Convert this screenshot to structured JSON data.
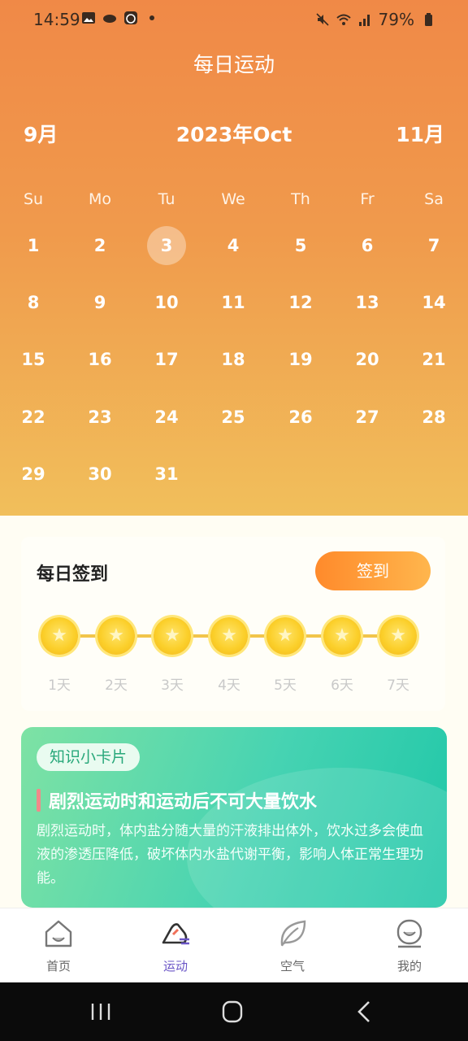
{
  "status_bar": {
    "time": "14:59",
    "battery": "79%",
    "icons_left": [
      "image-icon",
      "cloud-icon",
      "alarm-icon",
      "dot-icon"
    ],
    "icons_right": [
      "mute-icon",
      "wifi-icon",
      "signal-icon",
      "battery-icon"
    ]
  },
  "header": {
    "title": "每日运动",
    "prev_month": "9月",
    "current_month": "2023年Oct",
    "next_month": "11月"
  },
  "calendar": {
    "weekdays": [
      "Su",
      "Mo",
      "Tu",
      "We",
      "Th",
      "Fr",
      "Sa"
    ],
    "days": [
      "1",
      "2",
      "3",
      "4",
      "5",
      "6",
      "7",
      "8",
      "9",
      "10",
      "11",
      "12",
      "13",
      "14",
      "15",
      "16",
      "17",
      "18",
      "19",
      "20",
      "21",
      "22",
      "23",
      "24",
      "25",
      "26",
      "27",
      "28",
      "29",
      "30",
      "31"
    ],
    "selected_day": "3"
  },
  "signin": {
    "title": "每日签到",
    "button": "签到",
    "days": [
      "1天",
      "2天",
      "3天",
      "4天",
      "5天",
      "6天",
      "7天"
    ]
  },
  "knowledge": {
    "tag": "知识小卡片",
    "title": "剧烈运动时和运动后不可大量饮水",
    "body": "剧烈运动时，体内盐分随大量的汗液排出体外，饮水过多会使血液的渗透压降低，破坏体内水盐代谢平衡，影响人体正常生理功能。"
  },
  "tabbar": {
    "items": [
      {
        "label": "首页",
        "icon": "home-icon"
      },
      {
        "label": "运动",
        "icon": "running-shoe-icon"
      },
      {
        "label": "空气",
        "icon": "leaf-icon"
      },
      {
        "label": "我的",
        "icon": "profile-icon"
      }
    ],
    "active": "运动"
  },
  "colors": {
    "header_top": "#f08947",
    "header_bottom": "#f1bf5b",
    "accent_orange": "#ff8a2b",
    "knowledge_green": "#46d3b2",
    "active_tab": "#6a55c6"
  }
}
